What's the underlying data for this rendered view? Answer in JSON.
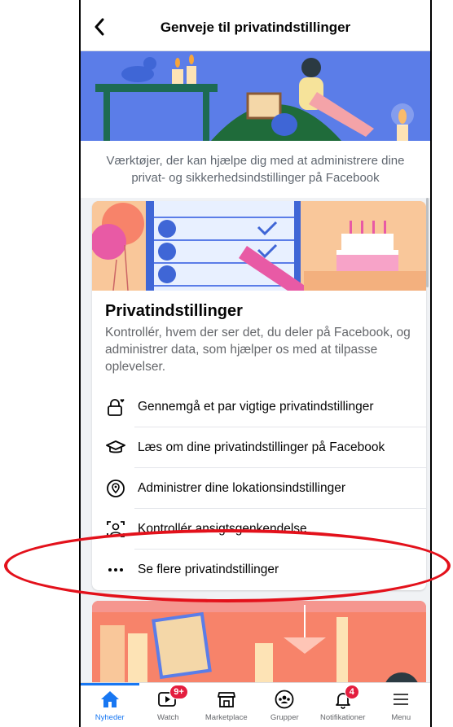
{
  "header": {
    "title": "Genveje til privatindstillinger"
  },
  "intro": {
    "text": "Værktøjer, der kan hjælpe dig med at administrere dine privat- og sikkerhedsindstillinger på Facebook"
  },
  "card": {
    "title": "Privatindstillinger",
    "description": "Kontrollér, hvem der ser det, du deler på Facebook, og administrer data, som hjælper os med at tilpasse oplevelser.",
    "options": [
      {
        "label": "Gennemgå et par vigtige privatindstillinger",
        "icon": "lock-heart-icon"
      },
      {
        "label": "Læs om dine privatindstillinger på Facebook",
        "icon": "graduation-cap-icon"
      },
      {
        "label": "Administrer dine lokationsindstillinger",
        "icon": "location-pin-icon"
      },
      {
        "label": "Kontrollér ansigtsgenkendelse",
        "icon": "face-recognition-icon"
      },
      {
        "label": "Se flere privatindstillinger",
        "icon": "more-dots-icon"
      }
    ]
  },
  "tabbar": {
    "tabs": [
      {
        "label": "Nyheder",
        "icon": "home-icon",
        "active": true
      },
      {
        "label": "Watch",
        "icon": "watch-video-icon",
        "badge": "9+"
      },
      {
        "label": "Marketplace",
        "icon": "marketplace-shop-icon"
      },
      {
        "label": "Grupper",
        "icon": "groups-icon"
      },
      {
        "label": "Notifikationer",
        "icon": "bell-icon",
        "badge": "4"
      },
      {
        "label": "Menu",
        "icon": "hamburger-menu-icon"
      }
    ]
  },
  "colors": {
    "accent": "#1877f2",
    "badge": "#e41e3f",
    "highlight": "#e3111b"
  }
}
